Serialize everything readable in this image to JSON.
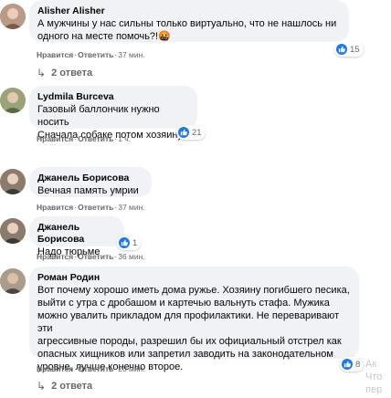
{
  "comments": [
    {
      "author": "Alisher Alisher",
      "text": "А мужчины у нас сильны только виртуально, что не нашлось ни одного на месте помочь?!",
      "emoji": "🤬",
      "like": "Нравится",
      "reply": "Ответить",
      "time": "37 мин.",
      "reactions": "15",
      "replies": "2 ответа"
    },
    {
      "author": "Lydmila Burceva",
      "text": "Газовый баллончик нужно носить\nСначала собаке потом хозяину.",
      "like": "Нравится",
      "reply": "Ответить",
      "time": "1 ч.",
      "reactions": "21"
    },
    {
      "author": "Джанель Борисова",
      "text": "Вечная память умрии",
      "like": "Нравится",
      "reply": "Ответить",
      "time": "37 мин."
    },
    {
      "author": "Джанель Борисова",
      "text": "Надо тюрьме",
      "like": "Нравится",
      "reply": "Ответить",
      "time": "36 мин.",
      "reactions": "1"
    },
    {
      "author": "Роман Родин",
      "text": "Вот почему хорошо иметь дома ружье. Хозяину погибшего песика,\nвыйти с утра с дробашом и картечью вальнуть стафа. Мужика\nможно увалить прикладом для профилактики. Не переваривают эти\nагрессивные породы, разрешил бы их официальный отстрел как\nопасных хищников или запретил заводить на законодательном\nуровне, лучше конечно второе.",
      "like": "Нравится",
      "reply": "Ответить",
      "time": "20 мин.",
      "reactions": "8",
      "replies": "2 ответа"
    }
  ],
  "side_text": [
    "Ак",
    "Что",
    "пер"
  ],
  "colors": {
    "bubble": "#f0f2f5",
    "meta": "#65676b",
    "like_blue": "#1877f2"
  },
  "icons": {
    "like": "thumbs-up-icon",
    "heart": "heart-icon",
    "reply_arrow": "reply-arrow-icon"
  }
}
